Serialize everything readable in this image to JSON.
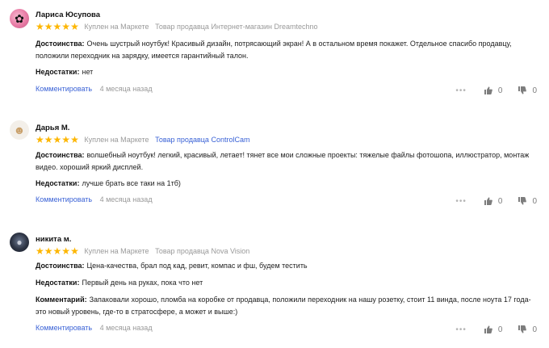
{
  "reviews": [
    {
      "author": "Лариса Юсупова",
      "avatar": "pink-flower",
      "rating": 5,
      "bought": "Куплен на Маркете",
      "seller": "Товар продавца Интернет-магазин Dreamtechno",
      "pros_label": "Достоинства:",
      "pros": "Очень шустрый ноутбук! Красивый дизайн, потрясающий экран! А в остальном время покажет. Отдельное спасибо продавцу, положили переходник на зарядку, имеется гарантийный талон.",
      "cons_label": "Недостатки:",
      "cons": "нет",
      "comment_link": "Комментировать",
      "date": "4 месяца назад",
      "likes": "0",
      "dislikes": "0"
    },
    {
      "author": "Дарья М.",
      "avatar": "doll",
      "rating": 5,
      "bought": "Куплен на Маркете",
      "seller": "Товар продавца ControlCam",
      "pros_label": "Достоинства:",
      "pros": "волшебный ноутбук! легкий, красивый, летает! тянет все мои сложные проекты: тяжелые файлы фотошопа, иллюстратор, монтаж видео. хороший яркий дисплей.",
      "cons_label": "Недостатки:",
      "cons": "лучше брать все таки на 1тб)",
      "comment_link": "Комментировать",
      "date": "4 месяца назад",
      "likes": "0",
      "dislikes": "0"
    },
    {
      "author": "никита м.",
      "avatar": "dark-photo",
      "rating": 5,
      "bought": "Куплен на Маркете",
      "seller": "Товар продавца Nova Vision",
      "pros_label": "Достоинства:",
      "pros": "Цена-качества, брал под кад, ревит, компас и фш, будем тестить",
      "cons_label": "Недостатки:",
      "cons": "Первый день на руках, пока что нет",
      "note_label": "Комментарий:",
      "note": "Запаковали хорошо, пломба на коробке от продавца, положили переходник на нашу розетку, стоит 11 винда, после ноута 17 года-это новый уровень, где-то в стратосфере, а может и выше:)",
      "comment_link": "Комментировать",
      "date": "4 месяца назад",
      "likes": "0",
      "dislikes": "0"
    }
  ],
  "colors": {
    "star": "#fdb600",
    "link": "#3a62d6",
    "muted": "#999999"
  },
  "icons": {
    "more": "more-dots-icon",
    "like": "thumb-up-icon",
    "dislike": "thumb-down-icon"
  }
}
